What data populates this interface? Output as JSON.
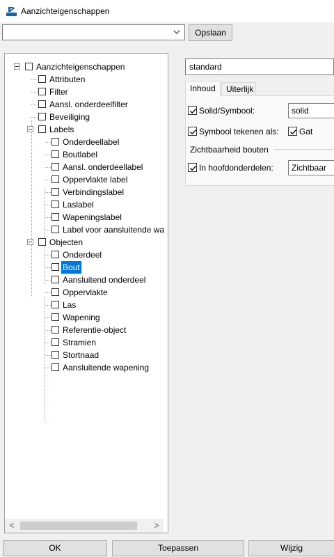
{
  "window": {
    "title": "Aanzichteigenschappen",
    "icon": "view-properties-app-icon"
  },
  "toolbar": {
    "settings_value": "",
    "save_label": "Opslaan"
  },
  "tree": {
    "root": {
      "label": "Aanzichteigenschappen",
      "checked": false,
      "expanded": true
    },
    "top_items": [
      {
        "label": "Attributen",
        "checked": false
      },
      {
        "label": "Filter",
        "checked": false
      },
      {
        "label": "Aansl. onderdeelfilter",
        "checked": false
      },
      {
        "label": "Beveiliging",
        "checked": false
      }
    ],
    "labels_group": {
      "label": "Labels",
      "checked": false,
      "expanded": true,
      "items": [
        {
          "label": "Onderdeellabel",
          "checked": false
        },
        {
          "label": "Boutlabel",
          "checked": false
        },
        {
          "label": "Aansl. onderdeellabel",
          "checked": false
        },
        {
          "label": "Oppervlakte label",
          "checked": false
        },
        {
          "label": "Verbindingslabel",
          "checked": false
        },
        {
          "label": "Laslabel",
          "checked": false
        },
        {
          "label": "Wapeningslabel",
          "checked": false
        },
        {
          "label": "Label voor aansluitende wa",
          "checked": false
        }
      ]
    },
    "objects_group": {
      "label": "Objecten",
      "checked": false,
      "expanded": true,
      "items": [
        {
          "label": "Onderdeel",
          "checked": false
        },
        {
          "label": "Bout",
          "checked": false,
          "selected": true
        },
        {
          "label": "Aansluitend onderdeel",
          "checked": false
        },
        {
          "label": "Oppervlakte",
          "checked": false
        },
        {
          "label": "Las",
          "checked": false
        },
        {
          "label": "Wapening",
          "checked": false
        },
        {
          "label": "Referentie-object",
          "checked": false
        },
        {
          "label": "Stramien",
          "checked": false
        },
        {
          "label": "Stortnaad",
          "checked": false
        },
        {
          "label": "Aansluitende wapening",
          "checked": false
        }
      ]
    },
    "scrollbar": {
      "left_arrow": "<",
      "right_arrow": ">"
    }
  },
  "properties": {
    "name_value": "standard",
    "tabs": [
      {
        "label": "Inhoud",
        "active": true
      },
      {
        "label": "Uiterlijk",
        "active": false
      }
    ],
    "solid_symbol": {
      "label": "Solid/Symbool:",
      "checked": true,
      "value": "solid"
    },
    "draw_symbol": {
      "label": "Symbool tekenen als:",
      "checked": true
    },
    "hole": {
      "label": "Gat",
      "checked": true
    },
    "group_title": "Zichtbaarheid bouten",
    "in_main_parts": {
      "label": "In hoofdonderdelen:",
      "checked": true,
      "value": "Zichtbaar"
    }
  },
  "buttons": {
    "ok": "OK",
    "apply": "Toepassen",
    "modify": "Wijzig"
  },
  "colors": {
    "selection": "#0078d7",
    "button_face": "#e1e1e1",
    "window_bg": "#f0f0f0"
  }
}
